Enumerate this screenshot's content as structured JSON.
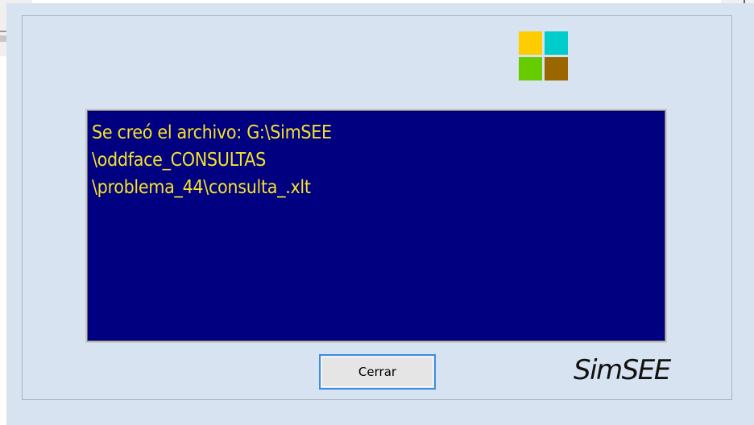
{
  "dialog": {
    "message_lines": [
      "Se creó el archivo: G:\\SimSEE",
      "\\oddface_CONSULTAS",
      "\\problema_44\\consulta_.xlt"
    ],
    "close_button_label": "Cerrar",
    "brand_text": "SimSEE"
  },
  "logo": {
    "icon": "simsee-logo-icon",
    "colors": [
      "#ffcc00",
      "#00cccc",
      "#66cc00",
      "#996600"
    ]
  },
  "colors": {
    "dialog_background": "#d7e3f0",
    "message_background": "#000080",
    "message_text": "#f7e22a",
    "button_focus_border": "#3a8ee6"
  }
}
